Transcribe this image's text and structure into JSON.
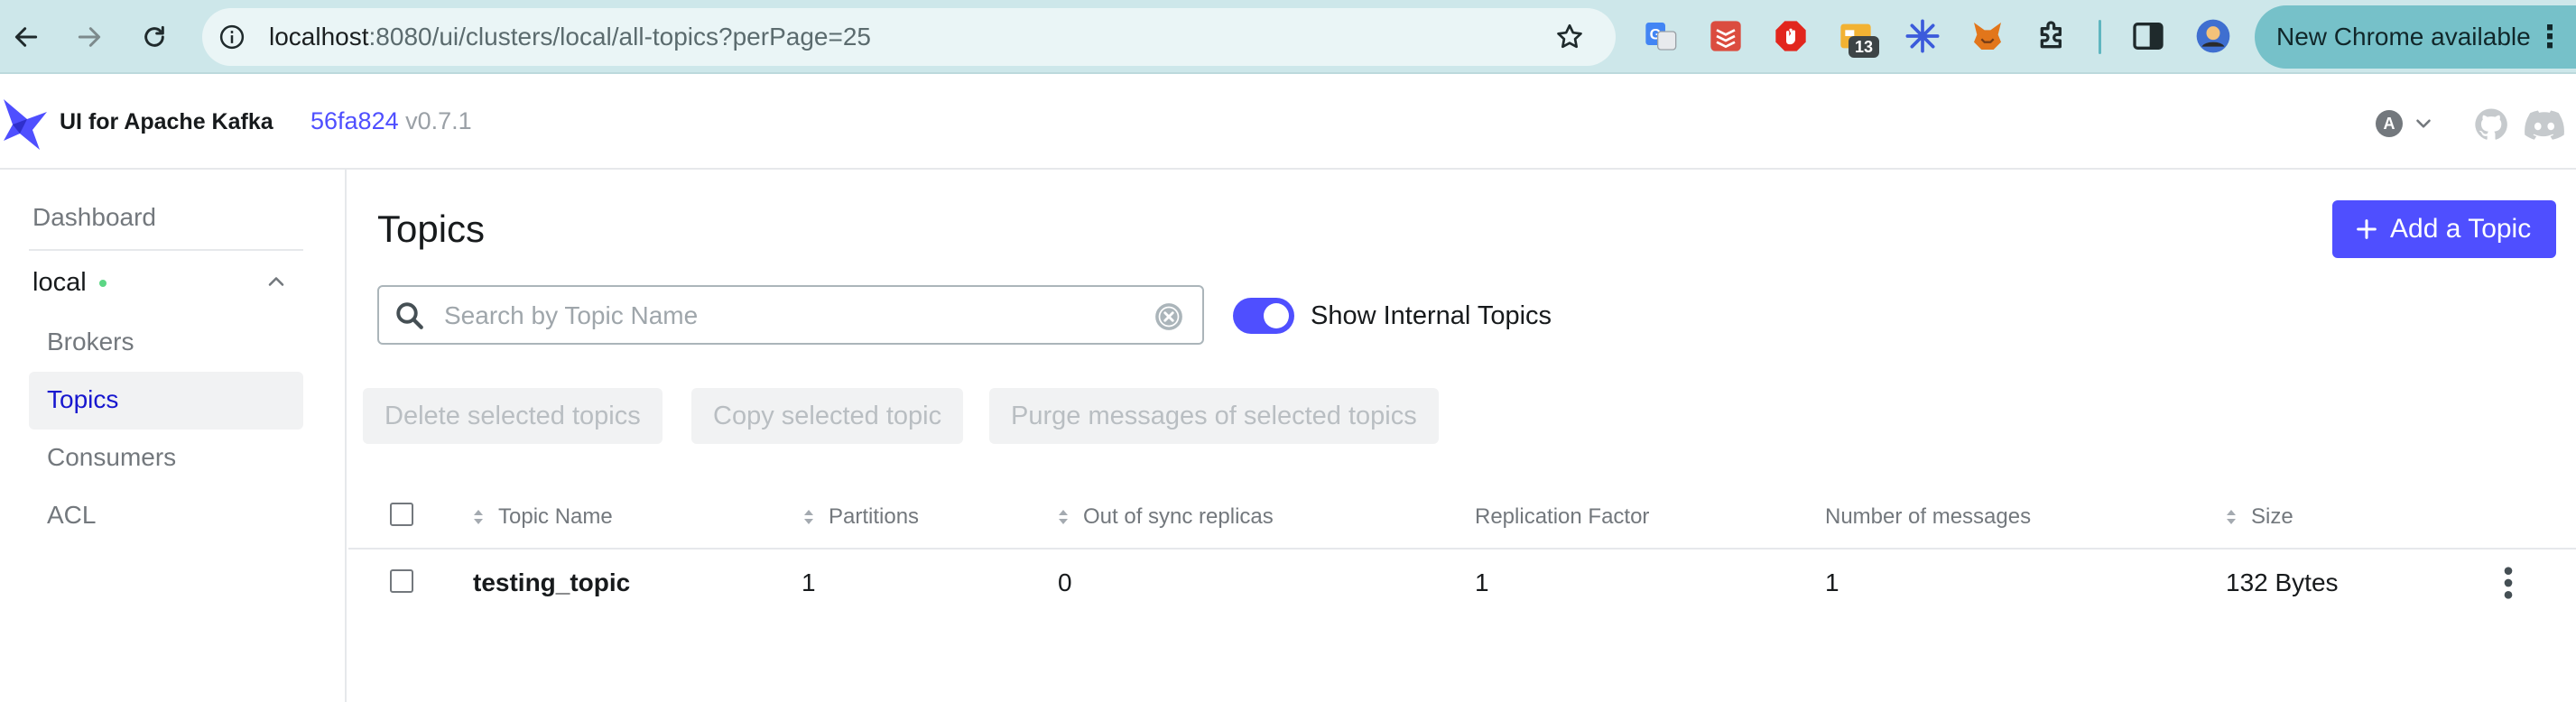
{
  "browser": {
    "url_host": "localhost",
    "url_rest": ":8080/ui/clusters/local/all-topics?perPage=25",
    "extension_badge": "13",
    "update_label": "New Chrome available",
    "icons": [
      "back-arrow-icon",
      "forward-arrow-icon",
      "reload-icon",
      "site-info-icon",
      "bookmark-star-icon",
      "translate-icon",
      "todoist-icon",
      "adblock-icon",
      "extension-badge-icon",
      "perplexity-icon",
      "metamask-icon",
      "puzzle-extensions-icon",
      "side-panel-icon",
      "profile-avatar-icon"
    ]
  },
  "header": {
    "app_name": "UI for Apache Kafka",
    "commit": "56fa824",
    "version": "v0.7.1",
    "user_initial": "A"
  },
  "sidebar": {
    "dashboard": "Dashboard",
    "cluster": "local",
    "items": [
      {
        "label": "Brokers"
      },
      {
        "label": "Topics"
      },
      {
        "label": "Consumers"
      },
      {
        "label": "ACL"
      }
    ],
    "active_item": "Topics"
  },
  "main": {
    "title": "Topics",
    "add_button": "Add a Topic",
    "search_placeholder": "Search by Topic Name",
    "search_value": "",
    "toggle_label": "Show Internal Topics",
    "toggle_on": true,
    "batch_actions": [
      "Delete selected topics",
      "Copy selected topic",
      "Purge messages of selected topics"
    ]
  },
  "table": {
    "columns": [
      "Topic Name",
      "Partitions",
      "Out of sync replicas",
      "Replication Factor",
      "Number of messages",
      "Size"
    ],
    "rows": [
      {
        "topic_name": "testing_topic",
        "partitions": "1",
        "out_of_sync_replicas": "0",
        "replication_factor": "1",
        "number_of_messages": "1",
        "size": "132 Bytes"
      }
    ]
  },
  "colors": {
    "accent": "#4f4fff",
    "active_nav": "#1717cf",
    "status_online": "#5cd685",
    "chrome_toolbar": "#cde7ea"
  }
}
